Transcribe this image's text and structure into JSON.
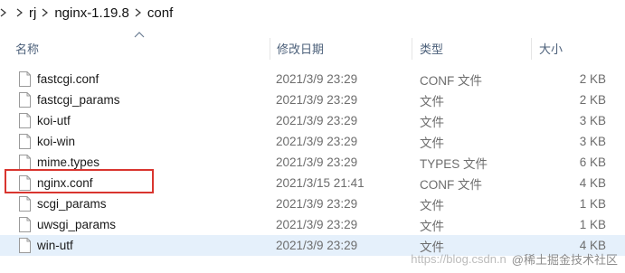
{
  "breadcrumb": {
    "items": [
      {
        "label": "rj"
      },
      {
        "label": "nginx-1.19.8"
      },
      {
        "label": "conf"
      }
    ]
  },
  "header": {
    "name": "名称",
    "modified": "修改日期",
    "type": "类型",
    "size": "大小"
  },
  "files": [
    {
      "name": "fastcgi.conf",
      "date": "2021/3/9 23:29",
      "type": "CONF 文件",
      "size": "2 KB"
    },
    {
      "name": "fastcgi_params",
      "date": "2021/3/9 23:29",
      "type": "文件",
      "size": "2 KB"
    },
    {
      "name": "koi-utf",
      "date": "2021/3/9 23:29",
      "type": "文件",
      "size": "3 KB"
    },
    {
      "name": "koi-win",
      "date": "2021/3/9 23:29",
      "type": "文件",
      "size": "3 KB"
    },
    {
      "name": "mime.types",
      "date": "2021/3/9 23:29",
      "type": "TYPES 文件",
      "size": "6 KB"
    },
    {
      "name": "nginx.conf",
      "date": "2021/3/15 21:41",
      "type": "CONF 文件",
      "size": "4 KB"
    },
    {
      "name": "scgi_params",
      "date": "2021/3/9 23:29",
      "type": "文件",
      "size": "1 KB"
    },
    {
      "name": "uwsgi_params",
      "date": "2021/3/9 23:29",
      "type": "文件",
      "size": "1 KB"
    },
    {
      "name": "win-utf",
      "date": "2021/3/9 23:29",
      "type": "文件",
      "size": "4 KB"
    }
  ],
  "highlighted_file": "nginx.conf",
  "watermark": {
    "text": "https://blog.csdn.n",
    "alt_text": "@稀土掘金技术社区"
  },
  "colors": {
    "highlight_border": "#d9352f",
    "selected_row_bg": "#e5f0fb",
    "header_text": "#4c607a"
  }
}
